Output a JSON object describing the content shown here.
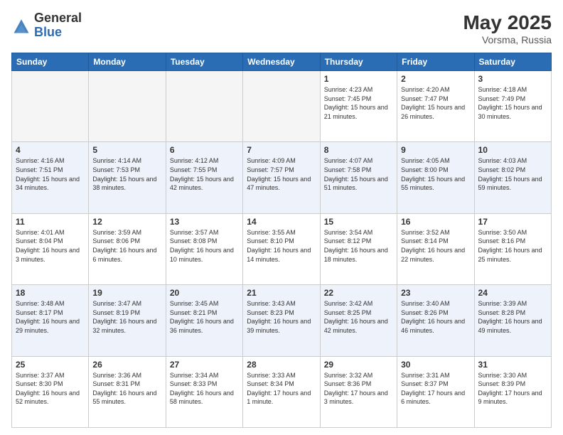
{
  "logo": {
    "general": "General",
    "blue": "Blue"
  },
  "title": {
    "month": "May 2025",
    "location": "Vorsma, Russia"
  },
  "headers": [
    "Sunday",
    "Monday",
    "Tuesday",
    "Wednesday",
    "Thursday",
    "Friday",
    "Saturday"
  ],
  "weeks": [
    [
      {
        "day": "",
        "info": ""
      },
      {
        "day": "",
        "info": ""
      },
      {
        "day": "",
        "info": ""
      },
      {
        "day": "",
        "info": ""
      },
      {
        "day": "1",
        "info": "Sunrise: 4:23 AM\nSunset: 7:45 PM\nDaylight: 15 hours and 21 minutes."
      },
      {
        "day": "2",
        "info": "Sunrise: 4:20 AM\nSunset: 7:47 PM\nDaylight: 15 hours and 26 minutes."
      },
      {
        "day": "3",
        "info": "Sunrise: 4:18 AM\nSunset: 7:49 PM\nDaylight: 15 hours and 30 minutes."
      }
    ],
    [
      {
        "day": "4",
        "info": "Sunrise: 4:16 AM\nSunset: 7:51 PM\nDaylight: 15 hours and 34 minutes."
      },
      {
        "day": "5",
        "info": "Sunrise: 4:14 AM\nSunset: 7:53 PM\nDaylight: 15 hours and 38 minutes."
      },
      {
        "day": "6",
        "info": "Sunrise: 4:12 AM\nSunset: 7:55 PM\nDaylight: 15 hours and 42 minutes."
      },
      {
        "day": "7",
        "info": "Sunrise: 4:09 AM\nSunset: 7:57 PM\nDaylight: 15 hours and 47 minutes."
      },
      {
        "day": "8",
        "info": "Sunrise: 4:07 AM\nSunset: 7:58 PM\nDaylight: 15 hours and 51 minutes."
      },
      {
        "day": "9",
        "info": "Sunrise: 4:05 AM\nSunset: 8:00 PM\nDaylight: 15 hours and 55 minutes."
      },
      {
        "day": "10",
        "info": "Sunrise: 4:03 AM\nSunset: 8:02 PM\nDaylight: 15 hours and 59 minutes."
      }
    ],
    [
      {
        "day": "11",
        "info": "Sunrise: 4:01 AM\nSunset: 8:04 PM\nDaylight: 16 hours and 3 minutes."
      },
      {
        "day": "12",
        "info": "Sunrise: 3:59 AM\nSunset: 8:06 PM\nDaylight: 16 hours and 6 minutes."
      },
      {
        "day": "13",
        "info": "Sunrise: 3:57 AM\nSunset: 8:08 PM\nDaylight: 16 hours and 10 minutes."
      },
      {
        "day": "14",
        "info": "Sunrise: 3:55 AM\nSunset: 8:10 PM\nDaylight: 16 hours and 14 minutes."
      },
      {
        "day": "15",
        "info": "Sunrise: 3:54 AM\nSunset: 8:12 PM\nDaylight: 16 hours and 18 minutes."
      },
      {
        "day": "16",
        "info": "Sunrise: 3:52 AM\nSunset: 8:14 PM\nDaylight: 16 hours and 22 minutes."
      },
      {
        "day": "17",
        "info": "Sunrise: 3:50 AM\nSunset: 8:16 PM\nDaylight: 16 hours and 25 minutes."
      }
    ],
    [
      {
        "day": "18",
        "info": "Sunrise: 3:48 AM\nSunset: 8:17 PM\nDaylight: 16 hours and 29 minutes."
      },
      {
        "day": "19",
        "info": "Sunrise: 3:47 AM\nSunset: 8:19 PM\nDaylight: 16 hours and 32 minutes."
      },
      {
        "day": "20",
        "info": "Sunrise: 3:45 AM\nSunset: 8:21 PM\nDaylight: 16 hours and 36 minutes."
      },
      {
        "day": "21",
        "info": "Sunrise: 3:43 AM\nSunset: 8:23 PM\nDaylight: 16 hours and 39 minutes."
      },
      {
        "day": "22",
        "info": "Sunrise: 3:42 AM\nSunset: 8:25 PM\nDaylight: 16 hours and 42 minutes."
      },
      {
        "day": "23",
        "info": "Sunrise: 3:40 AM\nSunset: 8:26 PM\nDaylight: 16 hours and 46 minutes."
      },
      {
        "day": "24",
        "info": "Sunrise: 3:39 AM\nSunset: 8:28 PM\nDaylight: 16 hours and 49 minutes."
      }
    ],
    [
      {
        "day": "25",
        "info": "Sunrise: 3:37 AM\nSunset: 8:30 PM\nDaylight: 16 hours and 52 minutes."
      },
      {
        "day": "26",
        "info": "Sunrise: 3:36 AM\nSunset: 8:31 PM\nDaylight: 16 hours and 55 minutes."
      },
      {
        "day": "27",
        "info": "Sunrise: 3:34 AM\nSunset: 8:33 PM\nDaylight: 16 hours and 58 minutes."
      },
      {
        "day": "28",
        "info": "Sunrise: 3:33 AM\nSunset: 8:34 PM\nDaylight: 17 hours and 1 minute."
      },
      {
        "day": "29",
        "info": "Sunrise: 3:32 AM\nSunset: 8:36 PM\nDaylight: 17 hours and 3 minutes."
      },
      {
        "day": "30",
        "info": "Sunrise: 3:31 AM\nSunset: 8:37 PM\nDaylight: 17 hours and 6 minutes."
      },
      {
        "day": "31",
        "info": "Sunrise: 3:30 AM\nSunset: 8:39 PM\nDaylight: 17 hours and 9 minutes."
      }
    ]
  ]
}
